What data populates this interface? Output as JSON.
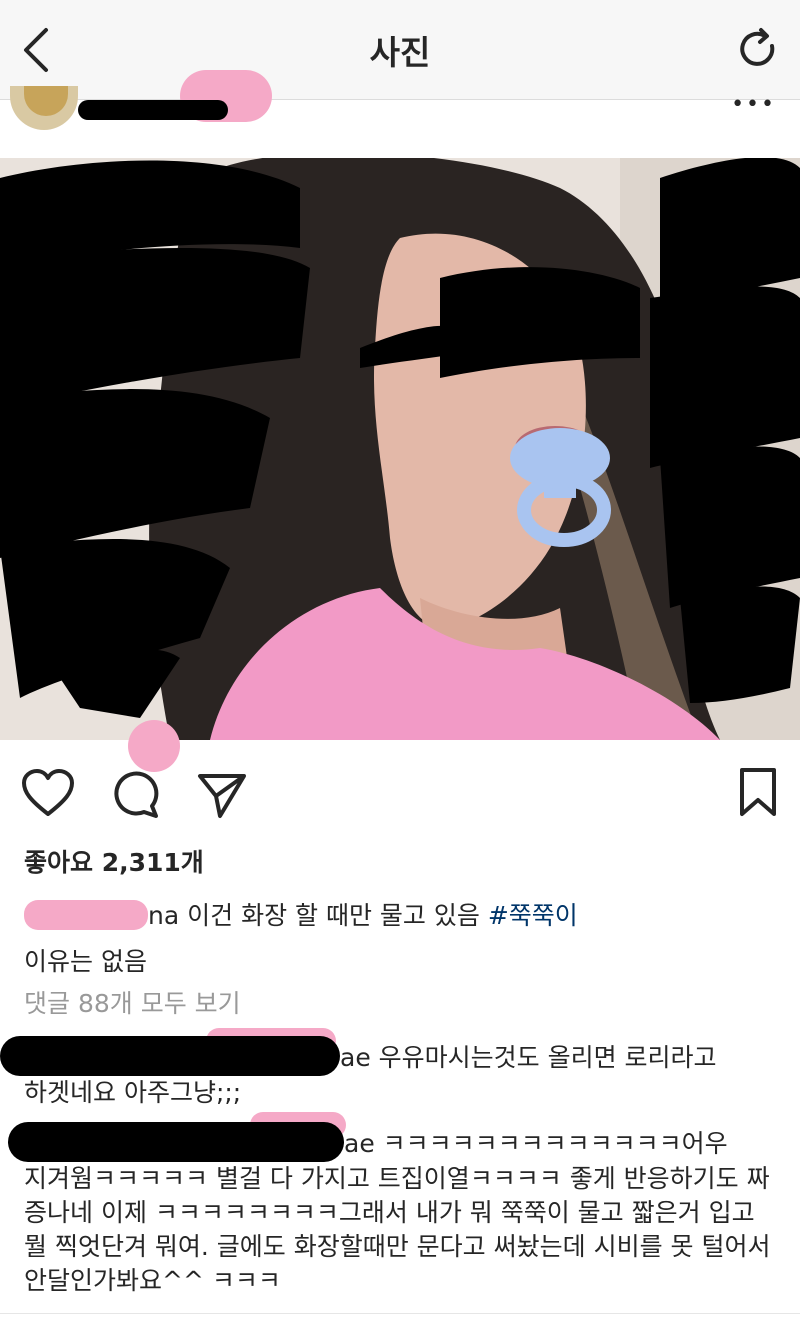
{
  "nav": {
    "title": "사진",
    "back_icon": "chevron-left-icon",
    "refresh_icon": "refresh-icon"
  },
  "post": {
    "more_icon": "more-dots-icon",
    "more_label": "•••",
    "actions": [
      "heart-icon",
      "comment-icon",
      "send-icon",
      "bookmark-icon"
    ],
    "likes": "좋아요 2,311개",
    "caption": {
      "username_tail": "na",
      "text": " 이건 화장 할 때만 물고 있음 ",
      "hashtag": "#쭉쭉이",
      "line2": "이유는 없음"
    },
    "view_all_comments": "댓글 88개 모두 보기",
    "comments": [
      {
        "username_tail": "ae",
        "line1": " 우유마시는것도 올리면 로리라고",
        "rest": "하겟네요 아주그냥;;;"
      },
      {
        "username_tail": "ae",
        "line1": " ㅋㅋㅋㅋㅋㅋㅋㅋㅋㅋㅋㅋㅋ어우",
        "rest": "지겨웜ㅋㅋㅋㅋㅋ 별걸 다 가지고 트집이열ㅋㅋㅋㅋ 좋게 반응하기도 짜증나네 이제 ㅋㅋㅋㅋㅋㅋㅋㅋ그래서 내가 뭐 쭉쭉이 물고 짧은거 입고 뭘 찍엇단겨 뭐여. 글에도 화장할때만 문다고 써놨는데 시비를 못 털어서 안달인가봐요^^ ㅋㅋㅋ"
      }
    ]
  },
  "colors": {
    "nav_bg": "#f7f7f7",
    "text": "#262626",
    "muted": "#999999",
    "hashtag": "#003569",
    "redact_pink": "#f5a9c7",
    "shirt_pink": "#f29ac6",
    "pacifier_blue": "#a9c4f0"
  }
}
